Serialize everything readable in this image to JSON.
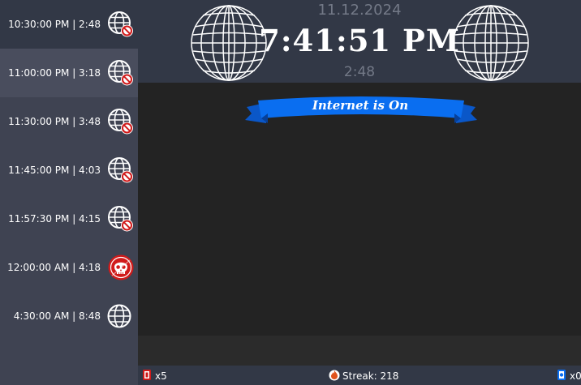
{
  "schedule": [
    {
      "label": "10:30:00 PM | 2:48",
      "icon": "globe-blocked-icon"
    },
    {
      "label": "11:00:00 PM | 3:18",
      "icon": "globe-blocked-icon"
    },
    {
      "label": "11:30:00 PM | 3:48",
      "icon": "globe-blocked-icon"
    },
    {
      "label": "11:45:00 PM | 4:03",
      "icon": "globe-blocked-icon"
    },
    {
      "label": "11:57:30 PM | 4:15",
      "icon": "globe-blocked-icon"
    },
    {
      "label": "12:00:00 AM | 4:18",
      "icon": "skull-icon"
    },
    {
      "label": "4:30:00 AM | 8:48",
      "icon": "globe-icon"
    }
  ],
  "header": {
    "date": "11.12.2024",
    "time": "7:41:51 PM",
    "countdown": "2:48"
  },
  "banner": {
    "text": "Internet is On"
  },
  "footer": {
    "left_count": "x5",
    "streak": "Streak: 218",
    "right_count": "x0"
  },
  "colors": {
    "sidebar_bg": "#3f4352",
    "sidebar_active_bg": "#323846",
    "sidebar_hover_bg": "#494d5d",
    "header_bg": "#323846",
    "main_bg": "#232323",
    "banner_blue": "#0a6ef0",
    "blocked_red": "#d11a1a"
  }
}
